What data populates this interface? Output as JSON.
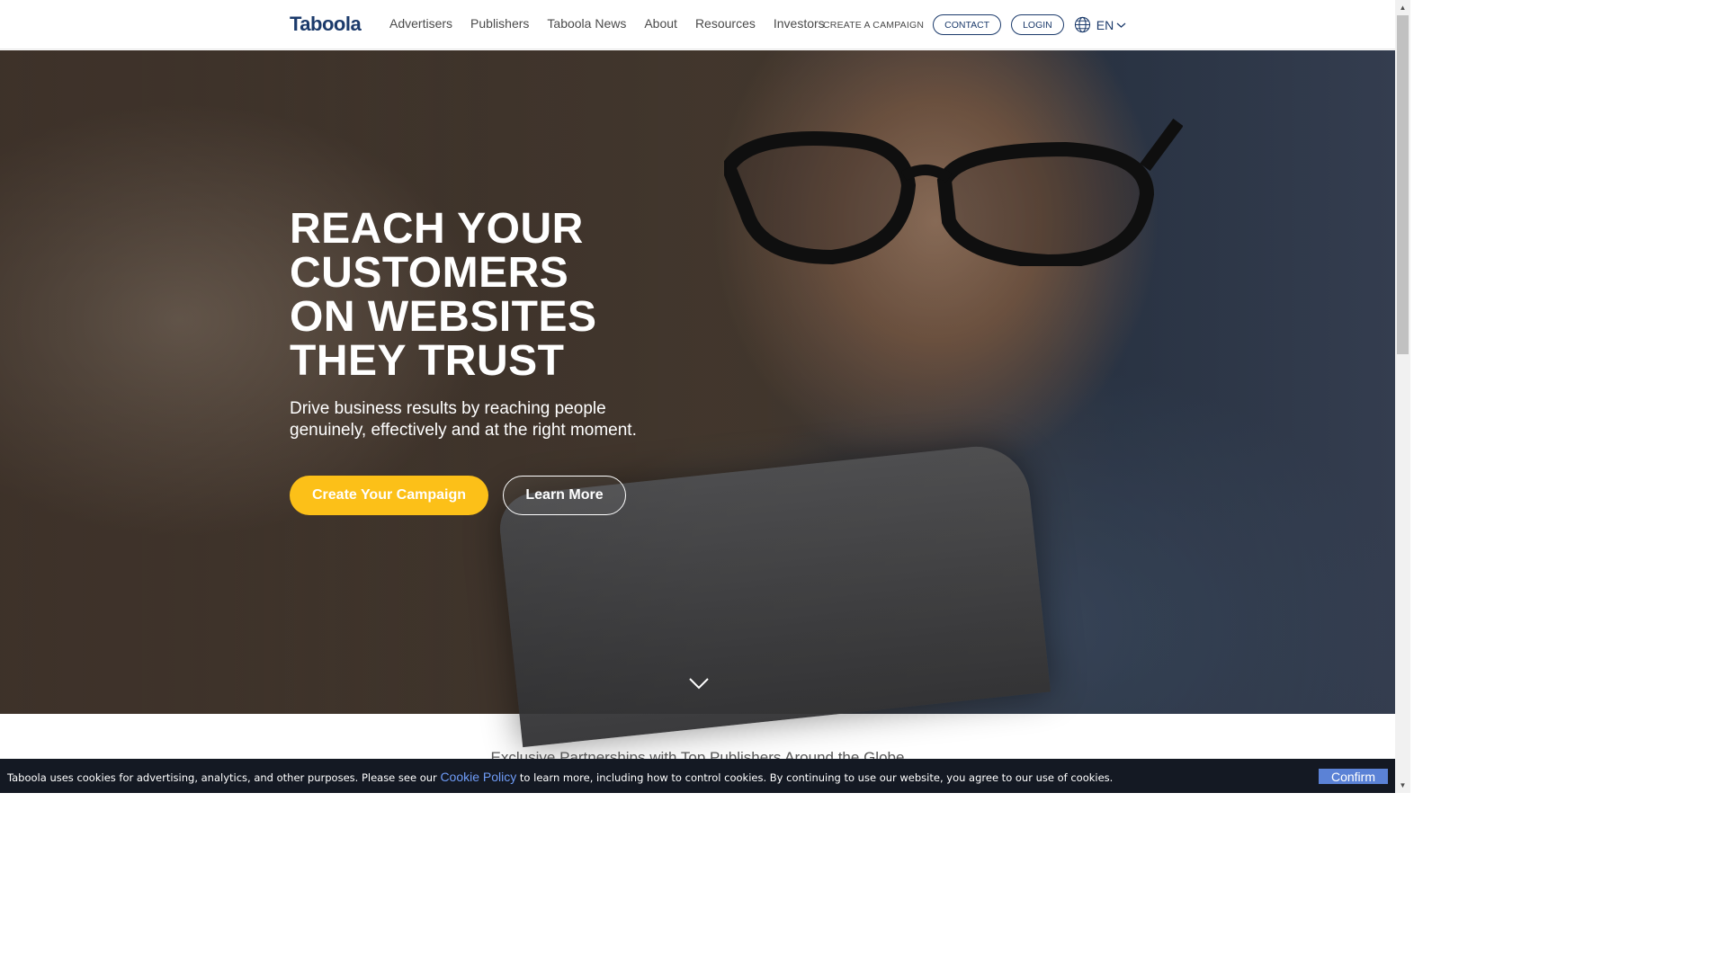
{
  "header": {
    "logo": "Taboola",
    "nav": [
      "Advertisers",
      "Publishers",
      "Taboola News",
      "About",
      "Resources",
      "Investors"
    ],
    "create_campaign": "CREATE A CAMPAIGN",
    "contact": "CONTACT",
    "login": "LOGIN",
    "language": "EN"
  },
  "hero": {
    "title_lines": [
      "REACH YOUR",
      "CUSTOMERS",
      "ON WEBSITES",
      "THEY TRUST"
    ],
    "subtitle": "Drive business results by reaching people genuinely, effectively and at the right moment.",
    "primary_cta": "Create Your Campaign",
    "secondary_cta": "Learn More"
  },
  "partners": {
    "heading": "Exclusive Partnerships with Top Publishers Around the Globe"
  },
  "cookie_bar": {
    "text_before": "Taboola uses cookies for advertising, analytics, and other purposes. Please see our ",
    "link": "Cookie Policy",
    "text_after": " to learn more, including how to control cookies. By continuing to use our website, you agree to our use of cookies.",
    "confirm": "Confirm"
  },
  "colors": {
    "brand_navy": "#1b3a6b",
    "cta_yellow": "#fcc018",
    "cookie_bg": "#141923",
    "confirm_blue": "#5b82d6"
  }
}
